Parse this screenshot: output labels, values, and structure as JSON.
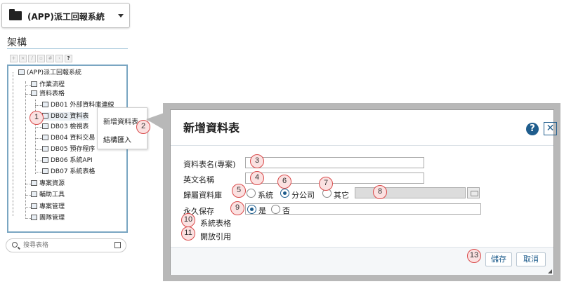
{
  "app_selector": {
    "label": "(APP)派工回報系統"
  },
  "left_panel": {
    "title": "架構",
    "search_placeholder": "搜尋表格",
    "tree": {
      "root": "(APP)派工回報系統",
      "items": [
        {
          "label": "作業流程"
        },
        {
          "label": "資料表格"
        },
        {
          "label": "DB01 外部資料庫連線"
        },
        {
          "label": "DB02 資料表"
        },
        {
          "label": "DB03 檢視表"
        },
        {
          "label": "DB04 資料交易"
        },
        {
          "label": "DB05 預存程序"
        },
        {
          "label": "DB06 系統API"
        },
        {
          "label": "DB07 系統表格"
        },
        {
          "label": "專案資源"
        },
        {
          "label": "輔助工具"
        },
        {
          "label": "專案管理"
        },
        {
          "label": "團隊管理"
        }
      ]
    }
  },
  "context_menu": {
    "items": [
      {
        "label": "新增資料表"
      },
      {
        "label": "結構匯入"
      }
    ]
  },
  "dialog": {
    "title": "新增資料表",
    "help_glyph": "?",
    "close_glyph": "✕",
    "fields": {
      "table_name_label": "資料表名(專案)",
      "english_name_label": "英文名稱",
      "database_label": "歸屬資料庫",
      "db_option_system": "系統",
      "db_option_branch": "分公司",
      "db_option_other": "其它",
      "permanent_label": "永久保存",
      "permanent_yes": "是",
      "permanent_no": "否",
      "system_table_label": "系統表格",
      "open_reference_label": "開放引用"
    },
    "buttons": {
      "save": "儲存",
      "cancel": "取消"
    }
  },
  "badges": [
    "1",
    "2",
    "3",
    "4",
    "5",
    "6",
    "7",
    "8",
    "9",
    "10",
    "11",
    "13"
  ],
  "colors": {
    "accent": "#1f5d8d",
    "badge_border": "#d94a4a",
    "badge_fill": "#fbe1e1",
    "frame": "#b8b8b8"
  }
}
